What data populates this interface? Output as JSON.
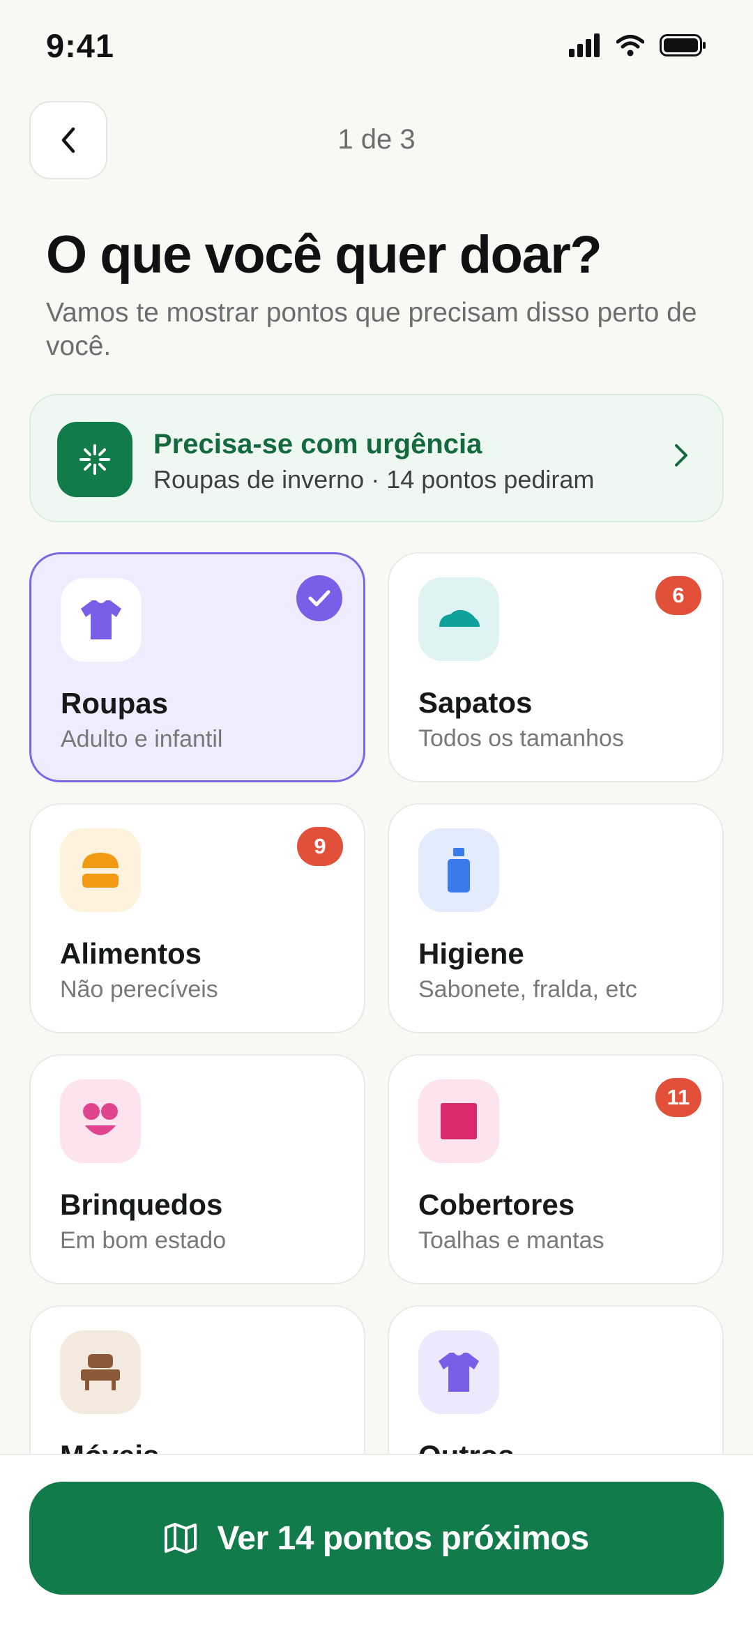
{
  "status_bar": {
    "time": "9:41"
  },
  "header": {
    "step": "1 de 3"
  },
  "page": {
    "title": "O que você quer doar?",
    "subtitle": "Vamos te mostrar pontos que precisam disso perto de você."
  },
  "urgent": {
    "title": "Precisa-se com urgência",
    "subtitle": "Roupas de inverno · 14 pontos pediram"
  },
  "categories": [
    {
      "name": "Roupas",
      "desc": "Adulto e infantil",
      "selected": true,
      "icon": "shirt-icon",
      "color": "#7b5ee8"
    },
    {
      "name": "Sapatos",
      "desc": "Todos os tamanhos",
      "badge": "6",
      "icon": "shoe-icon",
      "color": "#0fa19c"
    },
    {
      "name": "Alimentos",
      "desc": "Não perecíveis",
      "badge": "9",
      "icon": "burger-icon",
      "color": "#f29a14"
    },
    {
      "name": "Higiene",
      "desc": "Sabonete, fralda, etc",
      "icon": "soap-bottle-icon",
      "color": "#3b7bea"
    },
    {
      "name": "Brinquedos",
      "desc": "Em bom estado",
      "icon": "toy-face-icon",
      "color": "#e0448e"
    },
    {
      "name": "Cobertores",
      "desc": "Toalhas e mantas",
      "badge": "11",
      "icon": "blanket-icon",
      "color": "#d92a70"
    },
    {
      "name": "Móveis",
      "desc": "",
      "icon": "armchair-icon",
      "color": "#8a5a38"
    },
    {
      "name": "Outros",
      "desc": "",
      "icon": "shirt-icon",
      "color": "#7b5ee8"
    }
  ],
  "cta": {
    "label": "Ver 14 pontos próximos",
    "icon": "map-icon"
  },
  "colors": {
    "primary": "#117c4a",
    "selected": "#7b66e6",
    "badge": "#e2503a",
    "background": "#f8f8f5"
  }
}
